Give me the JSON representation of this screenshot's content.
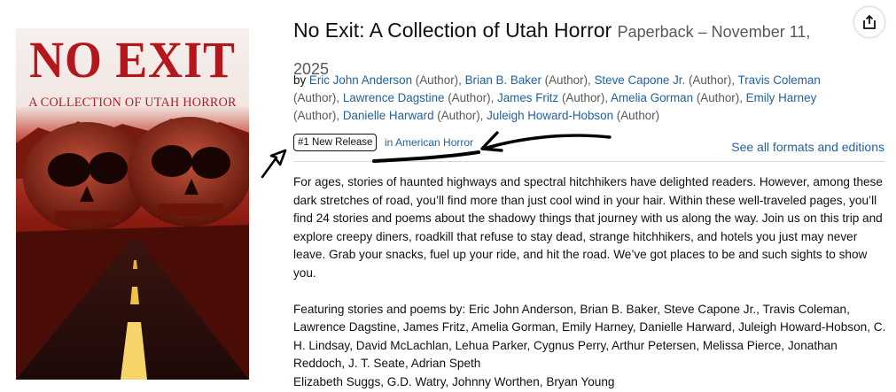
{
  "cover": {
    "title": "NO EXIT",
    "subtitle": "A COLLECTION OF UTAH HORROR"
  },
  "product": {
    "title": "No Exit: A Collection of Utah Horror",
    "format_date": "Paperback – November 11, 2025"
  },
  "byline": {
    "by": "by",
    "role": "(Author)",
    "authors": [
      "Eric John Anderson",
      "Brian B. Baker",
      "Steve Capone Jr.",
      "Travis Coleman",
      "Lawrence Dagstine",
      "James Fritz",
      "Amelia Gorman",
      "Emily Harney",
      "Danielle Harward",
      "Juleigh Howard-Hobson"
    ]
  },
  "badge": {
    "label": "#1 New Release",
    "category": "in American Horror"
  },
  "formats_link": "See all formats and editions",
  "description": {
    "para1": "For ages, stories of haunted highways and spectral hitchhikers have delighted readers. However, among these dark stretches of road, you’ll find more than just cool wind in your hair. Within these well-traveled pages, you’ll find 24 stories and poems about the shadowy things that journey with us along the way. Join us on this trip and explore creepy diners, roadkill that refuse to stay dead, strange hitchhikers, and hotels you just may never leave. Grab your snacks, fuel up your ride, and hit the road. We’ve got places to be and such sights to show you.",
    "para2": "Featuring stories and poems by: Eric John Anderson, Brian B. Baker, Steve Capone Jr., Travis Coleman, Lawrence Dagstine, James Fritz, Amelia Gorman, Emily Harney, Danielle Harward, Juleigh Howard-Hobson, C. H. Lindsay, David McLachlan, Lehua Parker, Cygnus Perry, Arthur Petersen, Melissa Pierce, Jonathan Reddoch, J. T. Seate, Adrian Speth",
    "para3": "Elizabeth Suggs, G.D. Watry, Johnny Worthen, Bryan Young"
  },
  "icons": {
    "share": "share-icon"
  }
}
